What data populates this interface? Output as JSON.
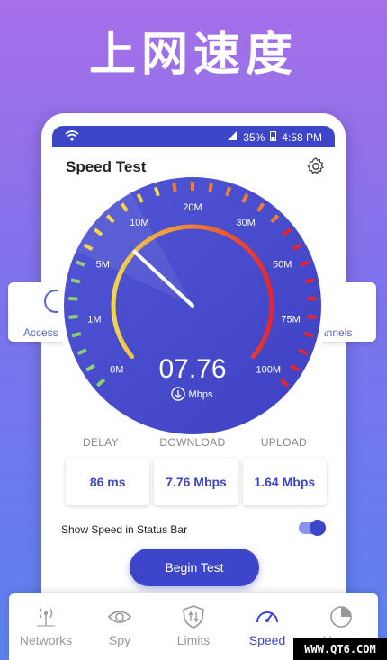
{
  "headline": "上网速度",
  "status_bar": {
    "battery": "35%",
    "time": "4:58 PM"
  },
  "app": {
    "title": "Speed Test"
  },
  "side_cards": {
    "left_label": "Access",
    "right_label": "annels"
  },
  "gauge": {
    "speed_value": "07.76",
    "unit": "Mbps",
    "needle_value": 7.76,
    "scale_labels": [
      "0M",
      "1M",
      "5M",
      "10M",
      "20M",
      "30M",
      "50M",
      "75M",
      "100M"
    ]
  },
  "stats": {
    "labels": [
      "DELAY",
      "DOWNLOAD",
      "UPLOAD"
    ],
    "values": [
      "86 ms",
      "7.76 Mbps",
      "1.64 Mbps"
    ]
  },
  "status_toggle": {
    "label": "Show Speed in Status Bar",
    "on": true
  },
  "begin_button": "Begin Test",
  "nav": [
    {
      "label": "Networks",
      "icon": "antenna-icon",
      "active": false
    },
    {
      "label": "Spy",
      "icon": "eye-icon",
      "active": false
    },
    {
      "label": "Limits",
      "icon": "shield-icon",
      "active": false
    },
    {
      "label": "Speed",
      "icon": "speedometer-icon",
      "active": true
    },
    {
      "label": "Usage",
      "icon": "pie-chart-icon",
      "active": false
    }
  ],
  "watermark": "WWW.QT6.COM",
  "colors": {
    "primary": "#3d46c8",
    "gauge_face": "#4b4fd0",
    "arc_start": "#f2d64b",
    "arc_end": "#e8252a"
  }
}
